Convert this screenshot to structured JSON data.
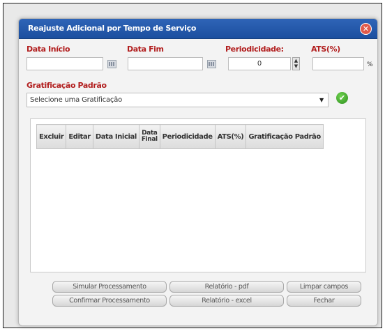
{
  "dialog": {
    "title": "Reajuste Adicional por Tempo de Serviço",
    "close_glyph": "✕"
  },
  "form": {
    "data_inicio_label": "Data Início",
    "data_inicio_value": "",
    "data_fim_label": "Data Fim",
    "data_fim_value": "",
    "periodicidade_label": "Periodicidade:",
    "periodicidade_value": "0",
    "ats_label": "ATS(%)",
    "ats_value": "",
    "ats_unit": "%",
    "gratificacao_label": "Gratificação Padrão",
    "gratificacao_selected": "Selecione uma Gratificação",
    "confirm_glyph": "✔"
  },
  "table": {
    "columns": [
      "Excluir",
      "Editar",
      "Data Inicial",
      "Data Final",
      "Periodicidade",
      "ATS(%)",
      "Gratificação Padrão"
    ],
    "rows": []
  },
  "buttons": {
    "simular": "Simular Processamento",
    "relatorio_pdf": "Relatório - pdf",
    "limpar": "Limpar campos",
    "confirmar": "Confirmar Processamento",
    "relatorio_excel": "Relatório - excel",
    "fechar": "Fechar"
  },
  "icons": {
    "calendar": "calendar-icon",
    "spinner": "spinner-icon",
    "dropdown": "chevron-down-icon",
    "confirm": "check-circle-icon",
    "close": "close-icon"
  },
  "colors": {
    "title_bar": "#1f56a8",
    "label_red": "#b21f1f",
    "confirm_green": "#2d8f1e",
    "close_red": "#e05a4a"
  }
}
